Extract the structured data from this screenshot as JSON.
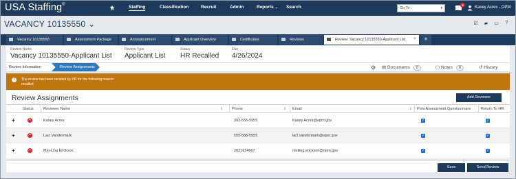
{
  "app": {
    "logo": "USA Staffing",
    "logo_mark": "®"
  },
  "topnav": {
    "items": [
      {
        "label": "Staffing",
        "active": true
      },
      {
        "label": "Classification"
      },
      {
        "label": "Recruit"
      },
      {
        "label": "Admin"
      },
      {
        "label": "Reports",
        "has_dropdown": true
      },
      {
        "label": "Search"
      }
    ],
    "goto_placeholder": "Go To",
    "mail_count": "2",
    "user_name": "Kasey Acres - OPM"
  },
  "vacancy": {
    "title": "VACANCY 10135550",
    "chevron": "⌄"
  },
  "tabs": [
    {
      "label": "Vacancy 10135550",
      "icon": "folder-icon"
    },
    {
      "label": "Assessment Package",
      "icon": "folder-icon"
    },
    {
      "label": "Announcement",
      "icon": "megaphone-icon"
    },
    {
      "label": "Applicant Overview",
      "icon": "users-icon"
    },
    {
      "label": "Certificates",
      "icon": "certificate-icon"
    },
    {
      "label": "Reviews",
      "icon": "thumbs-up-icon"
    },
    {
      "label": "Review: Vacancy 10135550-Applicant List",
      "icon": "thumbs-up-icon",
      "active": true
    }
  ],
  "review_info": {
    "name_label": "Review Name",
    "name_value": "Vacancy 10135550-Applicant List",
    "type_label": "Review Type",
    "type_value": "Applicant List",
    "status_label": "Status",
    "status_value": "HR Recalled",
    "due_label": "Due",
    "due_value": "4/26/2024"
  },
  "breadcrumb": {
    "step1": "Review Information",
    "step2": "Review Assignments"
  },
  "side_actions": {
    "documents_label": "Documents",
    "documents_count": "0",
    "notes_label": "Notes",
    "notes_count": "0",
    "history_label": "History"
  },
  "alert": {
    "message": "The review has been recalled by HR for the following reason:",
    "reason": "recalled",
    "color": "#c0760e"
  },
  "assignments": {
    "title": "Review Assignments",
    "add_button": "Add Reviewer",
    "columns": [
      "Status",
      "Reviewer Name",
      "Phone",
      "Email",
      "Print Assessment Questionnaire",
      "Return To HR"
    ],
    "rows": [
      {
        "name": "Kasey Acres",
        "phone": "202-555-5555",
        "email": "Kasey.Acres@opm.gov",
        "print": true,
        "return": true
      },
      {
        "name": "Laci Vandermark",
        "phone": "555-555-5555",
        "email": "laci.vandermark@opm.gov",
        "print": true,
        "return": true
      },
      {
        "name": "Mei-Ling Erickson",
        "phone": "2021234567",
        "email": "meiling.erickson@opm.gov",
        "print": true,
        "return": true
      }
    ]
  },
  "footer": {
    "save": "Save",
    "send": "Send Review"
  },
  "colors": {
    "navy": "#1d3a5c",
    "accent_blue": "#2f79b9",
    "status_red": "#d8232a"
  }
}
